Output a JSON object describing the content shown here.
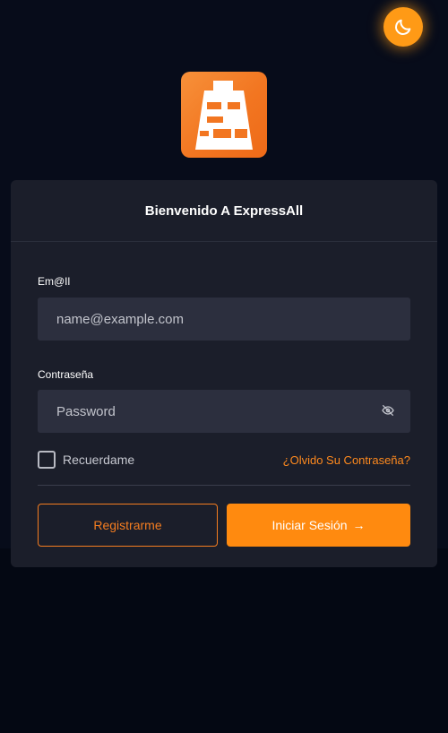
{
  "card": {
    "title": "Bienvenido A ExpressAll"
  },
  "email": {
    "label": "Em@Il",
    "placeholder": "name@example.com",
    "value": ""
  },
  "password": {
    "label": "Contraseña",
    "placeholder": "Password",
    "value": ""
  },
  "remember": {
    "label": "Recuerdame",
    "checked": false
  },
  "forgot_link": "¿Olvido Su Contraseña?",
  "buttons": {
    "register_label": "Registrarme",
    "login_label": "Iniciar Sesión",
    "login_icon": "→"
  },
  "icons": {
    "theme_toggle": "moon-icon",
    "logo": "shopping-bag-logo",
    "password_visibility": "eye-off-icon"
  },
  "colors": {
    "accent": "#ff8a0f",
    "card_bg": "#1b1e2a",
    "input_bg": "#2c2f3e",
    "page_bg": "#070c1a"
  }
}
